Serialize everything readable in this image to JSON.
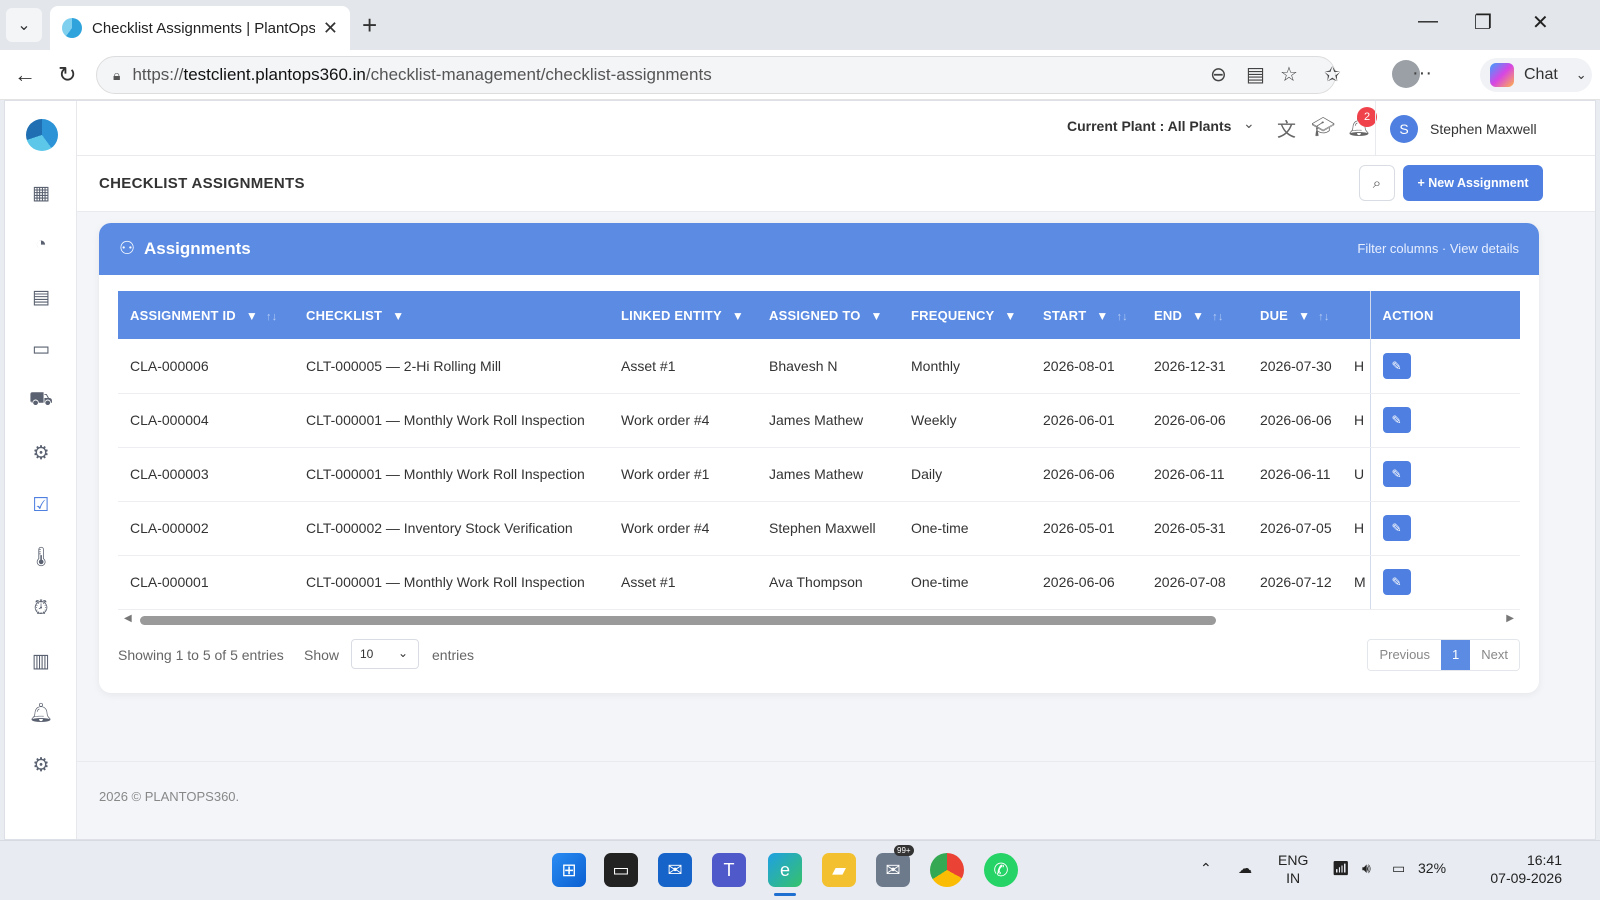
{
  "browser": {
    "tab_title": "Checklist Assignments | PlantOps",
    "url_prefix": "https://",
    "url_host": "testclient.plantops360.in",
    "url_path": "/checklist-management/checklist-assignments",
    "chat_label": "Chat"
  },
  "topbar": {
    "current_plant": "Current Plant : All Plants",
    "notification_count": "2",
    "user_initial": "S",
    "user_name": "Stephen Maxwell"
  },
  "page": {
    "title": "CHECKLIST ASSIGNMENTS",
    "new_button": "+ New Assignment"
  },
  "card": {
    "title": "Assignments",
    "links": "Filter columns · View details"
  },
  "table": {
    "headers": [
      "ASSIGNMENT ID",
      "CHECKLIST",
      "LINKED ENTITY",
      "ASSIGNED TO",
      "FREQUENCY",
      "START",
      "END",
      "DUE",
      "ACTION"
    ],
    "rows": [
      {
        "id": "CLA-000006",
        "checklist": "CLT-000005 — 2-Hi Rolling Mill",
        "entity": "Asset #1",
        "assigned": "Bhavesh N",
        "frequency": "Monthly",
        "start": "2026-08-01",
        "end": "2026-12-31",
        "due": "2026-07-30",
        "extra": "H"
      },
      {
        "id": "CLA-000004",
        "checklist": "CLT-000001 — Monthly Work Roll Inspection",
        "entity": "Work order #4",
        "assigned": "James Mathew",
        "frequency": "Weekly",
        "start": "2026-06-01",
        "end": "2026-06-06",
        "due": "2026-06-06",
        "extra": "H"
      },
      {
        "id": "CLA-000003",
        "checklist": "CLT-000001 — Monthly Work Roll Inspection",
        "entity": "Work order #1",
        "assigned": "James Mathew",
        "frequency": "Daily",
        "start": "2026-06-06",
        "end": "2026-06-11",
        "due": "2026-06-11",
        "extra": "U"
      },
      {
        "id": "CLA-000002",
        "checklist": "CLT-000002 — Inventory Stock Verification",
        "entity": "Work order #4",
        "assigned": "Stephen Maxwell",
        "frequency": "One-time",
        "start": "2026-05-01",
        "end": "2026-05-31",
        "due": "2026-07-05",
        "extra": "H"
      },
      {
        "id": "CLA-000001",
        "checklist": "CLT-000001 — Monthly Work Roll Inspection",
        "entity": "Asset #1",
        "assigned": "Ava Thompson",
        "frequency": "One-time",
        "start": "2026-06-06",
        "end": "2026-07-08",
        "due": "2026-07-12",
        "extra": "M"
      }
    ]
  },
  "pagination": {
    "info": "Showing 1 to 5 of 5 entries",
    "show_label": "Show",
    "page_size": "10",
    "entries_label": "entries",
    "previous": "Previous",
    "current": "1",
    "next": "Next"
  },
  "footer": {
    "copyright": "2026 © PLANTOPS360."
  },
  "taskbar": {
    "lang_top": "ENG",
    "lang_bottom": "IN",
    "battery": "32%",
    "time": "16:41",
    "date": "07-09-2026",
    "mail_badge": "99+"
  },
  "colors": {
    "accent": "#5b8be2",
    "button": "#4f7fe0",
    "badge": "#f0424b"
  }
}
